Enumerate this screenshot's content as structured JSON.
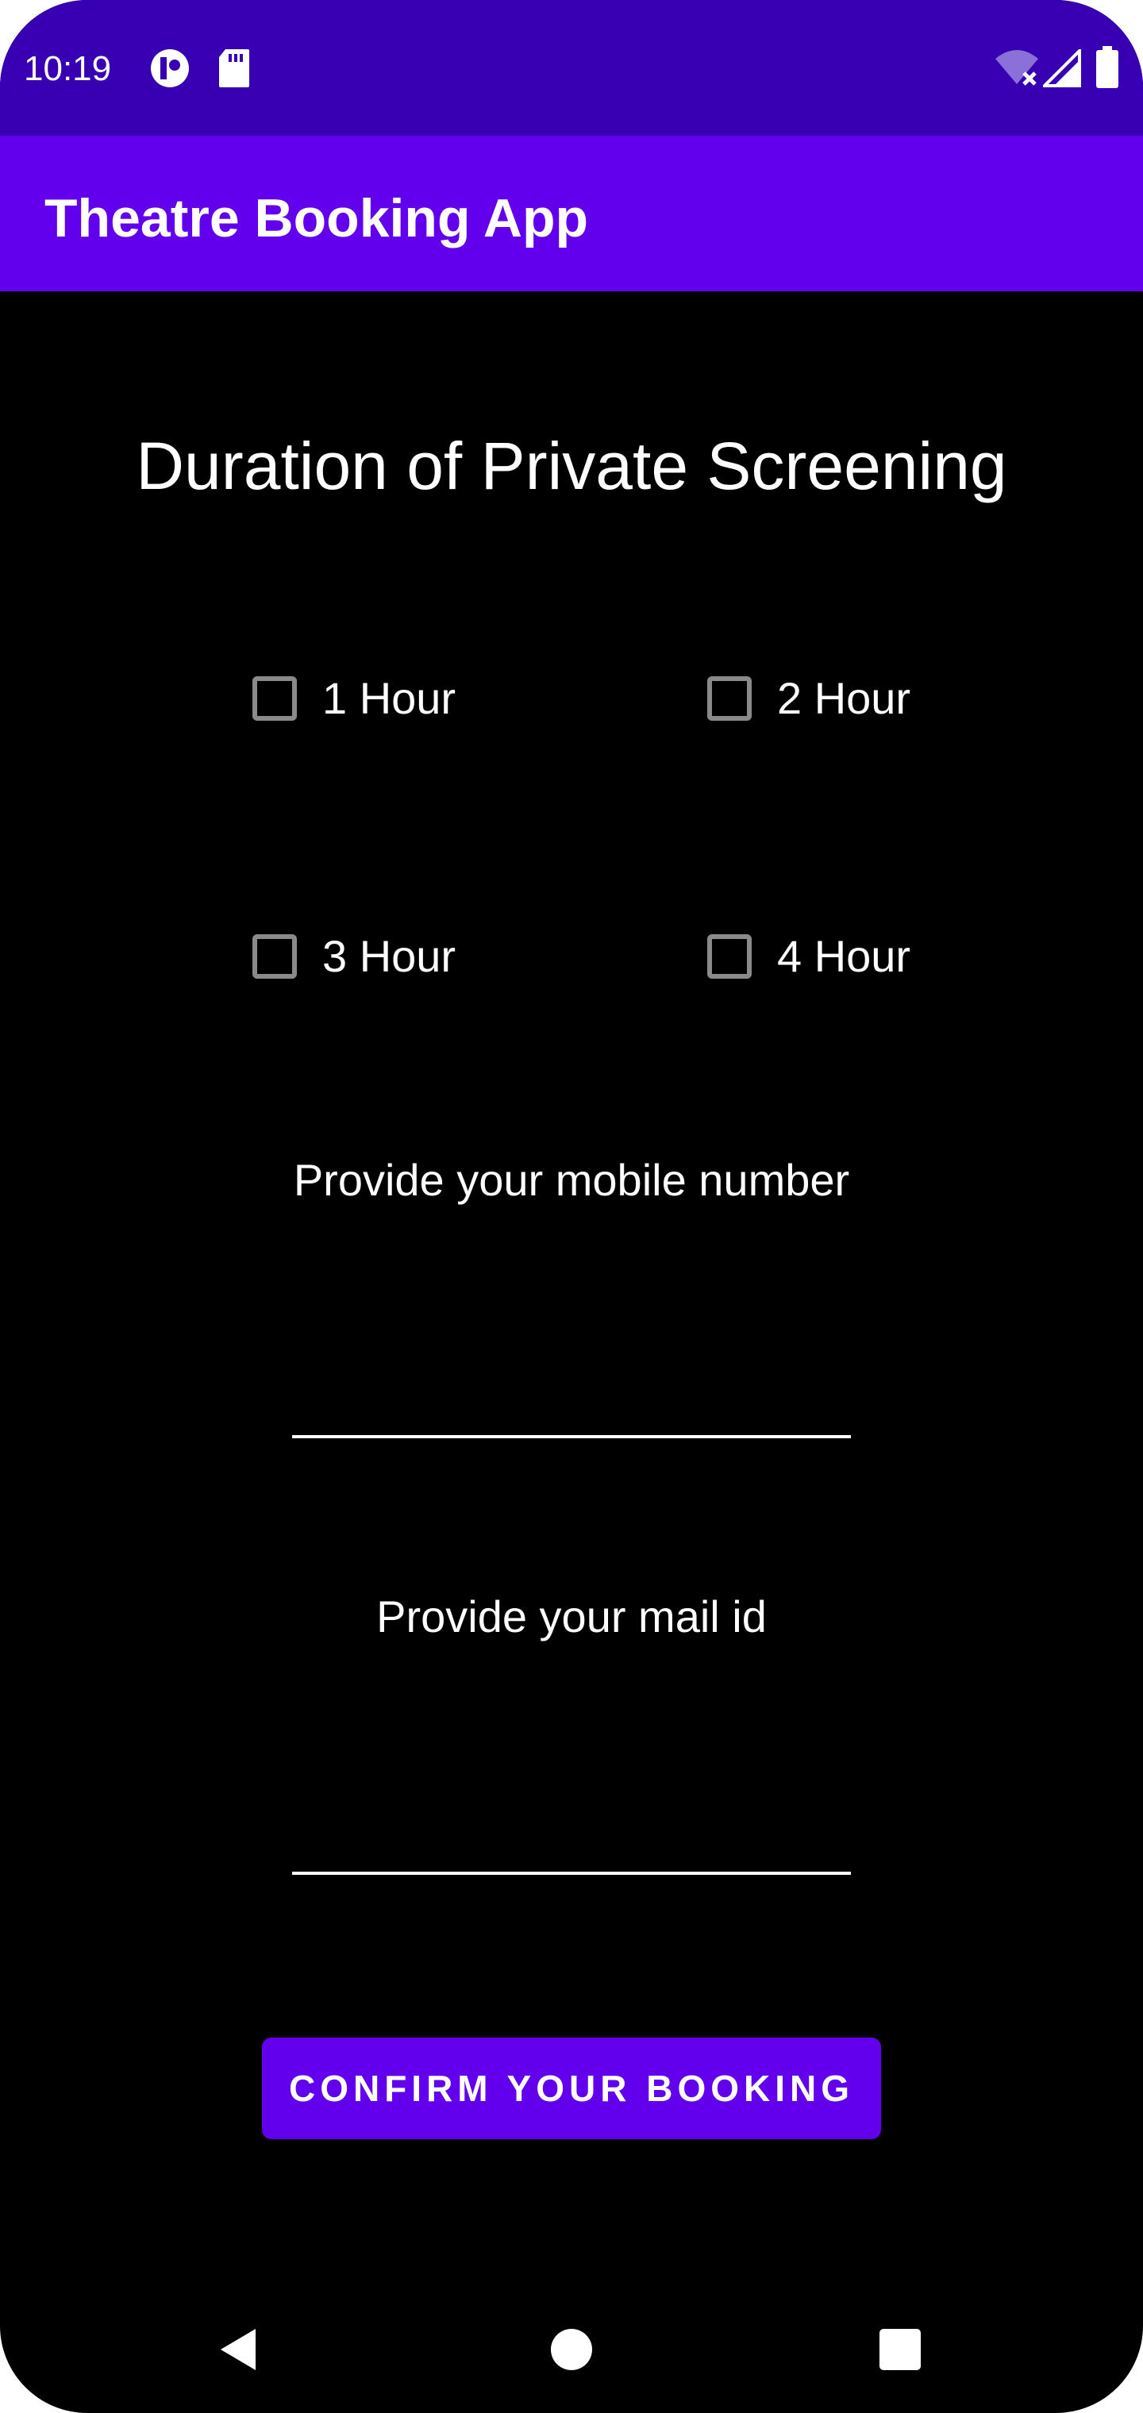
{
  "status_bar": {
    "time": "10:19",
    "icons": [
      "media-notification-icon",
      "sd-card-icon",
      "wifi-off-icon",
      "signal-icon",
      "battery-icon"
    ]
  },
  "app_bar": {
    "title": "Theatre Booking App"
  },
  "main": {
    "heading": "Duration of Private Screening",
    "duration_options": [
      {
        "label": "1 Hour",
        "checked": false
      },
      {
        "label": "2 Hour",
        "checked": false
      },
      {
        "label": "3 Hour",
        "checked": false
      },
      {
        "label": "4 Hour",
        "checked": false
      }
    ],
    "mobile_label": "Provide your mobile number",
    "mobile_value": "",
    "mail_label": "Provide your mail id",
    "mail_value": "",
    "confirm_label": "CONFIRM YOUR BOOKING"
  },
  "nav_bar": {
    "icons": [
      "back-icon",
      "home-icon",
      "recents-icon"
    ]
  },
  "colors": {
    "status_bar": "#3700b3",
    "primary": "#6200ee",
    "background": "#000000",
    "text": "#ffffff",
    "checkbox_border": "#8a8a8a"
  }
}
